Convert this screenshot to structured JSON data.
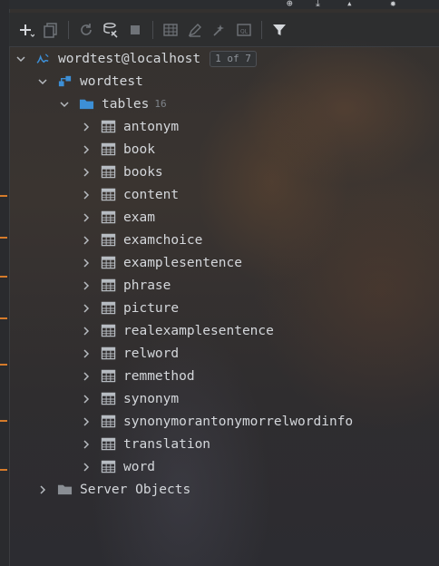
{
  "toolbar": {
    "buttons": [
      "add-icon",
      "duplicate-icon",
      "refresh-icon",
      "schema-tools-icon",
      "stop-icon",
      "table-icon",
      "edit-icon",
      "jump-icon",
      "console-icon",
      "filter-icon"
    ]
  },
  "tree": {
    "connection": {
      "label": "wordtest@localhost",
      "badge": "1 of 7"
    },
    "database": {
      "label": "wordtest"
    },
    "tables_folder": {
      "label": "tables",
      "count": "16"
    },
    "tables": [
      "antonym",
      "book",
      "books",
      "content",
      "exam",
      "examchoice",
      "examplesentence",
      "phrase",
      "picture",
      "realexamplesentence",
      "relword",
      "remmethod",
      "synonym",
      "synonymorantonymorrelwordinfo",
      "translation",
      "word"
    ],
    "server_objects": {
      "label": "Server Objects"
    }
  },
  "colors": {
    "accent_blue": "#3d8fd6",
    "gutter_marker": "#d57b2a",
    "text": "#d4d7db"
  }
}
